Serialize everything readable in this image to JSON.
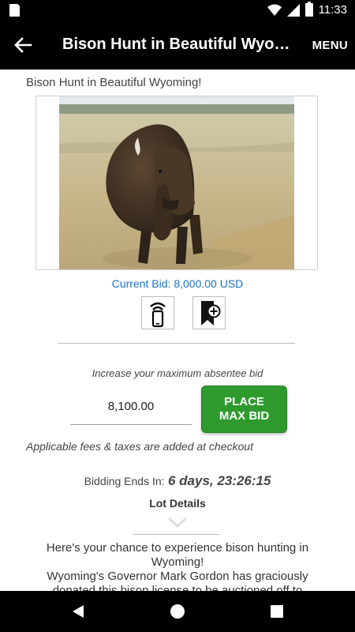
{
  "status_bar": {
    "time": "11:33"
  },
  "app_bar": {
    "title": "Bison Hunt in Beautiful Wyoming!",
    "menu_label": "MENU"
  },
  "listing": {
    "subtitle": "Bison Hunt in Beautiful Wyoming!",
    "current_bid": "Current Bid: 8,000.00 USD",
    "increase_label": "Increase your maximum absentee bid",
    "bid_value": "8,100.00",
    "place_bid_line1": "PLACE",
    "place_bid_line2": "MAX BID",
    "fees_note": "Applicable fees & taxes are added at checkout",
    "bidding_ends_label": "Bidding Ends In:",
    "bidding_ends_value": "6 days, 23:26:15",
    "lot_details_label": "Lot Details",
    "description_line1": "Here's your chance to experience bison hunting in Wyoming!",
    "description_line2": "Wyoming's Governor Mark Gordon has graciously donated this bison license to be auctioned off to"
  },
  "colors": {
    "accent_blue": "#1a73c6",
    "button_green": "#2e9a2e"
  }
}
